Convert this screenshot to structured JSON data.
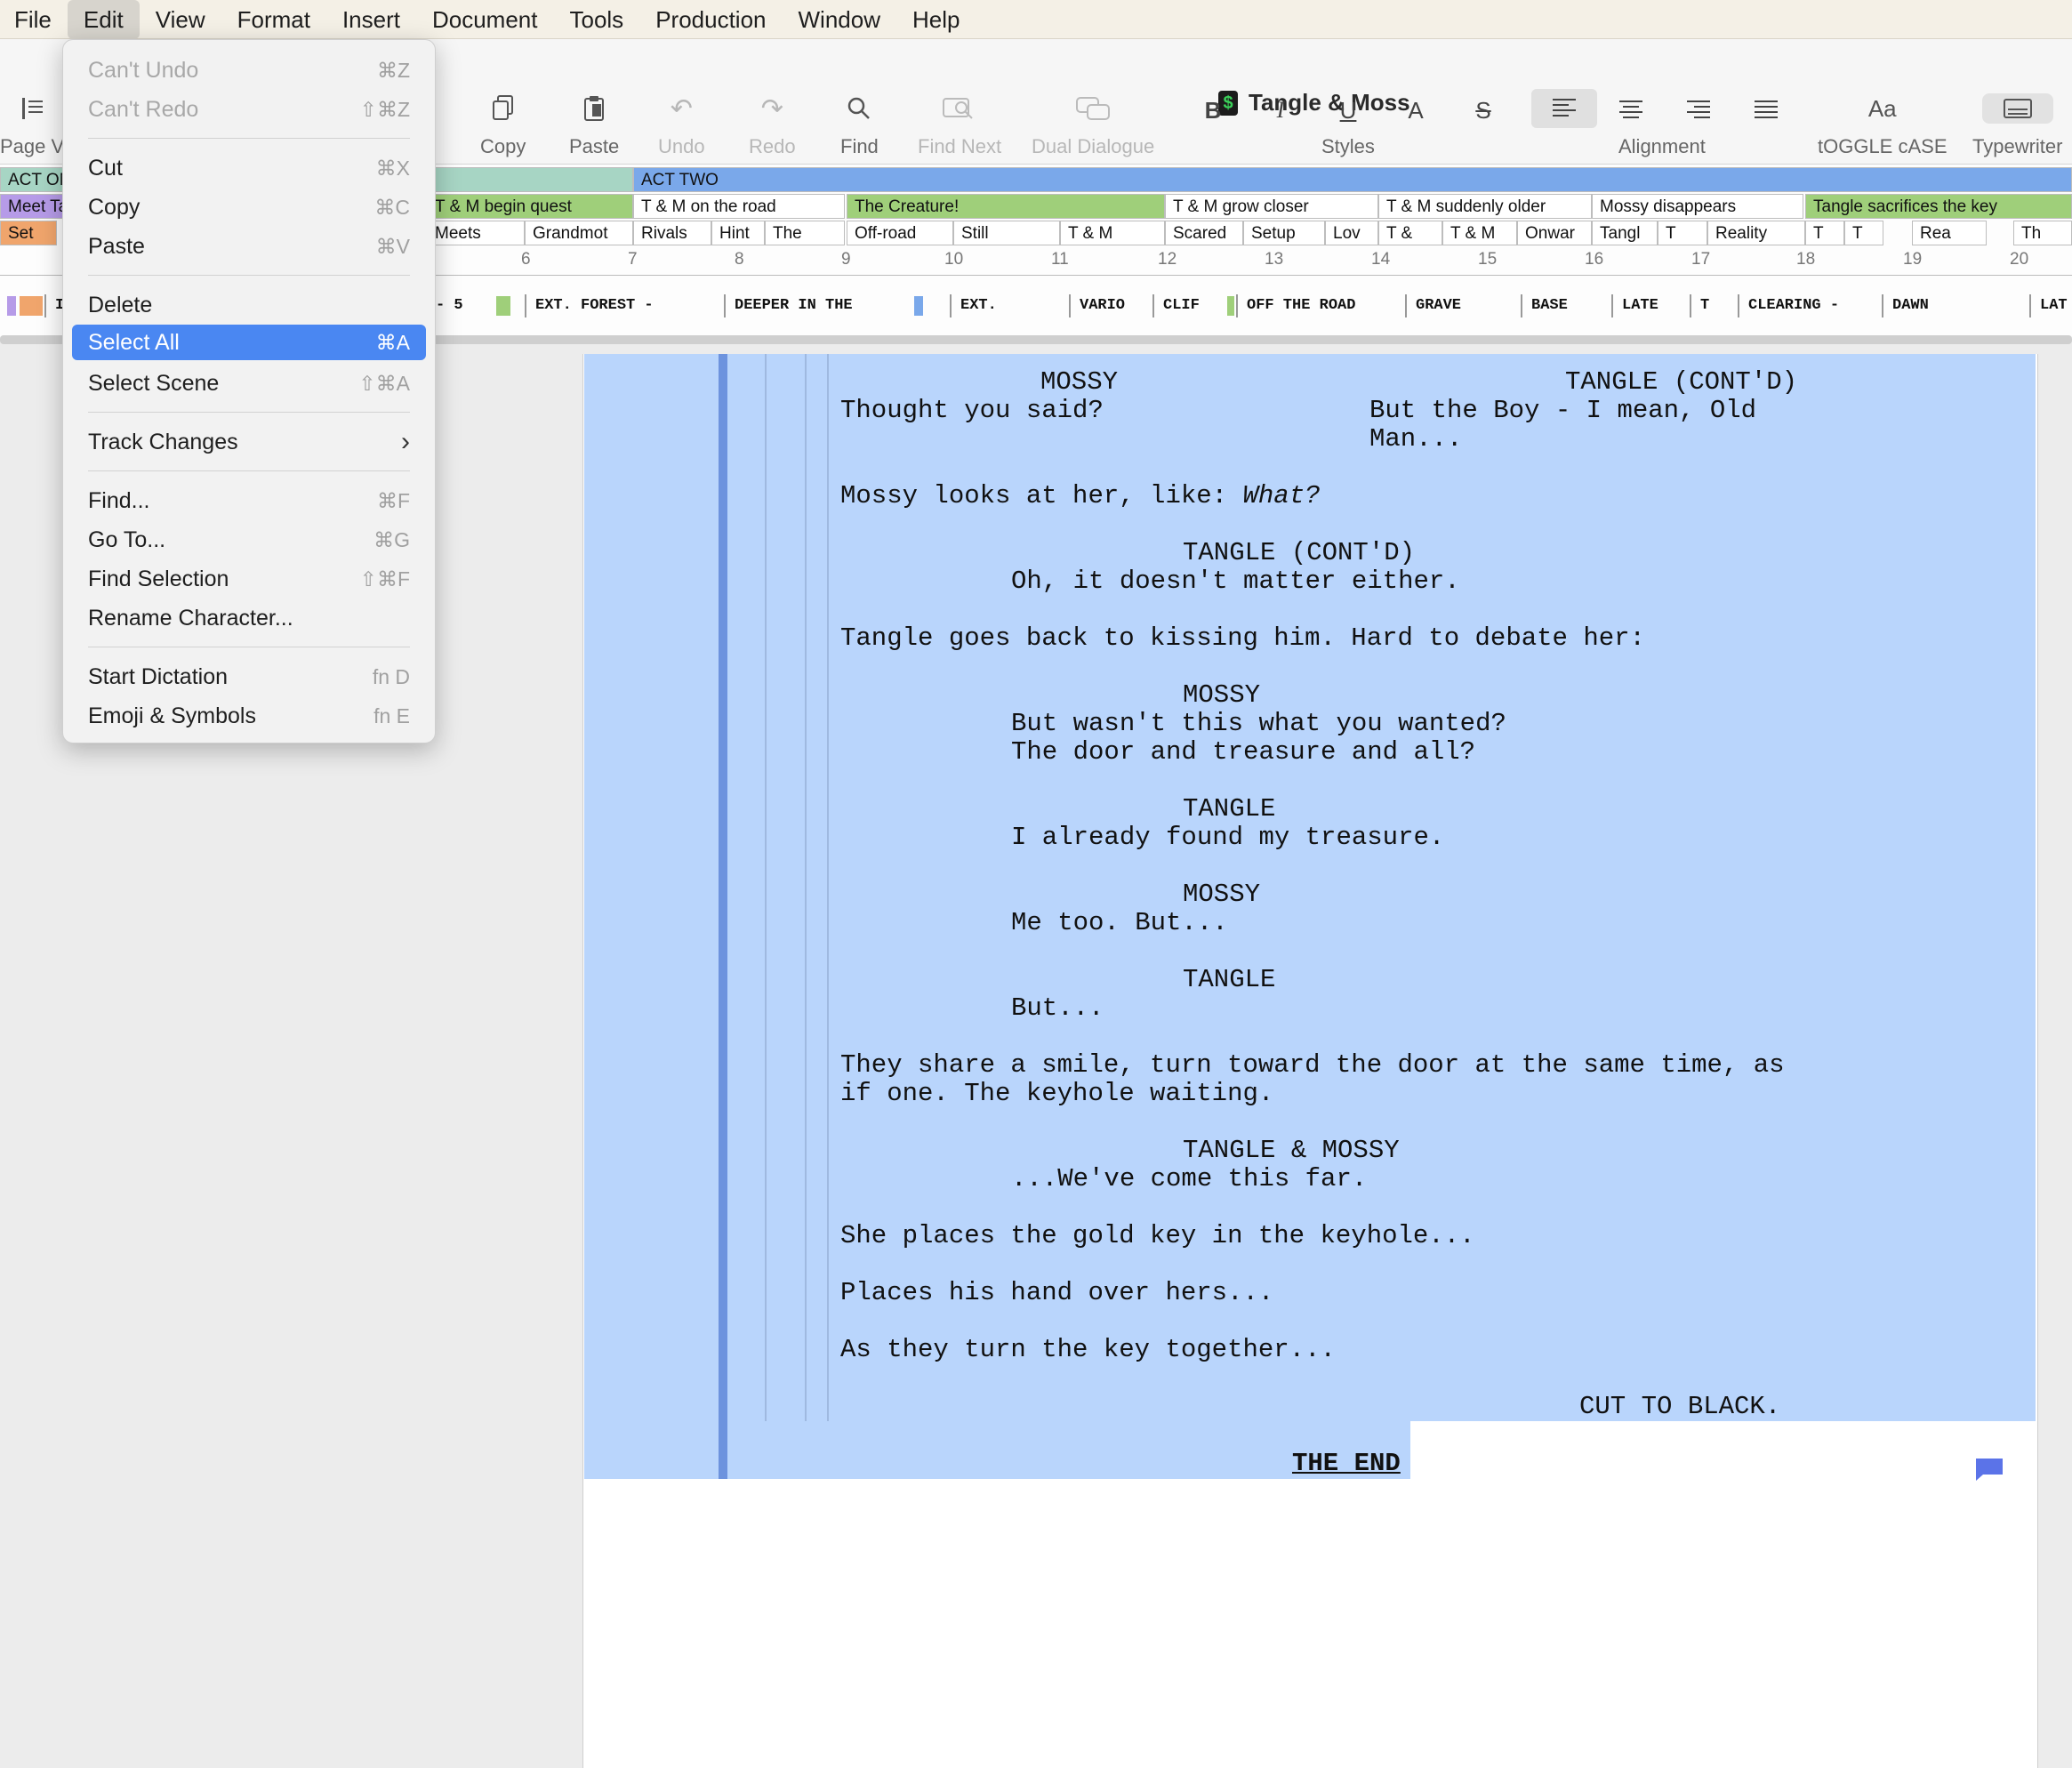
{
  "menubar": [
    "File",
    "Edit",
    "View",
    "Format",
    "Insert",
    "Document",
    "Tools",
    "Production",
    "Window",
    "Help"
  ],
  "window": {
    "title": "Tangle & Moss",
    "app_icon_glyph": "$"
  },
  "toolbar": {
    "page_view_label": "Page V",
    "copy": "Copy",
    "paste": "Paste",
    "undo": "Undo",
    "redo": "Redo",
    "find": "Find",
    "find_next": "Find Next",
    "dual_dialogue": "Dual Dialogue",
    "bold": "B",
    "italic": "I",
    "underline": "U",
    "font_a": "A",
    "strike": "S",
    "styles_label": "Styles",
    "alignment_label": "Alignment",
    "toggle_case_icon": "Aa",
    "toggle_case": "tOGGLE cASE",
    "typewriter": "Typewriter"
  },
  "timeline": {
    "acts": [
      "ACT ON",
      "ACT TWO"
    ],
    "sequences": [
      "Meet Ta",
      "T & M begin quest",
      "T & M on the road",
      "The Creature!",
      "T & M grow closer",
      "T & M suddenly older",
      "Mossy disappears",
      "Tangle sacrifices the key"
    ],
    "scenes": [
      "Set",
      "Meets",
      "Grandmot",
      "Rivals",
      "Hint",
      "The",
      "Off-road",
      "Still",
      "T & M",
      "Scared",
      "Setup",
      "Lov",
      "T &",
      "T & M",
      "Onwar",
      "Tangl",
      "T",
      "Reality",
      "T",
      "T",
      "Rea",
      "Th"
    ],
    "ruler": [
      "6",
      "7",
      "8",
      "9",
      "10",
      "11",
      "12",
      "13",
      "14",
      "15",
      "16",
      "17",
      "18",
      "19",
      "20"
    ],
    "sluglines": [
      "I",
      "- 5",
      "EXT. FOREST -",
      "DEEPER IN THE",
      "EXT.",
      "VARIO",
      "CLIF",
      "OFF THE ROAD",
      "GRAVE",
      "BASE",
      "LATE",
      "T",
      "CLEARING -",
      "DAWN",
      "LAT"
    ]
  },
  "script": {
    "dual_left_char": "MOSSY",
    "dual_left_line": "Thought you said?",
    "dual_right_char": "TANGLE (CONT'D)",
    "dual_right_line1": "But the Boy - I mean, Old",
    "dual_right_line2": "Man...",
    "action1_a": "Mossy looks at her, like: ",
    "action1_b": "What?",
    "char2": "TANGLE (CONT'D)",
    "dlg2": "Oh, it doesn't matter either.",
    "action2": "Tangle goes back to kissing him. Hard to debate her:",
    "char3": "MOSSY",
    "dlg3a": "But wasn't this what you wanted?",
    "dlg3b": "The door and treasure and all?",
    "char4": "TANGLE",
    "dlg4": "I already found my treasure.",
    "char5": "MOSSY",
    "dlg5": "Me too. But...",
    "char6": "TANGLE",
    "dlg6": "But...",
    "action3a": "They share a smile, turn toward the door at the same time, as",
    "action3b": "if one. The keyhole waiting.",
    "char7": "TANGLE & MOSSY",
    "dlg7": "...We've come this far.",
    "action4": "She places the gold key in the keyhole...",
    "action5": "Places his hand over hers...",
    "action6": "As they turn the key together...",
    "transition": "CUT TO BLACK.",
    "end": "THE END"
  },
  "edit_menu": [
    {
      "label": "Can't Undo",
      "shortcut": "⌘Z",
      "disabled": true
    },
    {
      "label": "Can't Redo",
      "shortcut": "⇧⌘Z",
      "disabled": true
    },
    {
      "label": "Cut",
      "shortcut": "⌘X"
    },
    {
      "label": "Copy",
      "shortcut": "⌘C"
    },
    {
      "label": "Paste",
      "shortcut": "⌘V"
    },
    {
      "label": "Delete",
      "shortcut": ""
    },
    {
      "label": "Select All",
      "shortcut": "⌘A",
      "highlighted": true
    },
    {
      "label": "Select Scene",
      "shortcut": "⇧⌘A"
    },
    {
      "label": "Track Changes",
      "shortcut": "›"
    },
    {
      "label": "Find...",
      "shortcut": "⌘F"
    },
    {
      "label": "Go To...",
      "shortcut": "⌘G"
    },
    {
      "label": "Find Selection",
      "shortcut": "⇧⌘F"
    },
    {
      "label": "Rename Character...",
      "shortcut": ""
    },
    {
      "label": "Start Dictation",
      "shortcut": "fn D"
    },
    {
      "label": "Emoji & Symbols",
      "shortcut": "fn E"
    }
  ],
  "colors": {
    "selection": "#b9d5fc",
    "menu_highlight": "#4a87f2",
    "act_one": "#a7d5c4",
    "act_two": "#7aa8ea",
    "seq_green": "#9fcf7a",
    "seq_purple": "#b69be8",
    "scene_orange": "#f0a56c"
  }
}
